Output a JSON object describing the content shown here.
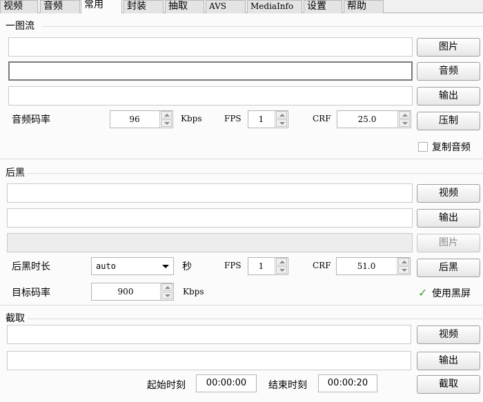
{
  "tabs": [
    {
      "label": "视频"
    },
    {
      "label": "音频"
    },
    {
      "label": "常用"
    },
    {
      "label": "封装"
    },
    {
      "label": "抽取"
    },
    {
      "label": "AVS"
    },
    {
      "label": "MediaInfo"
    },
    {
      "label": "设置"
    },
    {
      "label": "帮助"
    }
  ],
  "active_tab": "常用",
  "section1": {
    "title": "一图流",
    "image_path": "",
    "audio_path": "",
    "output_path": "",
    "btn_image": "图片",
    "btn_audio": "音频",
    "btn_output": "输出",
    "btn_compress": "压制",
    "audio_bitrate_label": "音频码率",
    "audio_bitrate_value": "96",
    "kbps_label": "Kbps",
    "fps_label": "FPS",
    "fps_value": "1",
    "crf_label": "CRF",
    "crf_value": "25.0",
    "copy_audio_label": "复制音频",
    "copy_audio_checked": false
  },
  "section2": {
    "title": "后黑",
    "video_path": "",
    "output_path": "",
    "image_path": "",
    "btn_video": "视频",
    "btn_output": "输出",
    "btn_image": "图片",
    "btn_black": "后黑",
    "duration_label": "后黑时长",
    "duration_value": "auto",
    "seconds_label": "秒",
    "fps_label": "FPS",
    "fps_value": "1",
    "crf_label": "CRF",
    "crf_value": "51.0",
    "target_bitrate_label": "目标码率",
    "target_bitrate_value": "900",
    "kbps_label": "Kbps",
    "use_black_label": "使用黑屏",
    "use_black_checked": true
  },
  "section3": {
    "title": "截取",
    "video_path": "",
    "output_path": "",
    "btn_video": "视频",
    "btn_output": "输出",
    "btn_cut": "截取",
    "start_label": "起始时刻",
    "start_value": "00:00:00",
    "end_label": "结束时刻",
    "end_value": "00:00:20"
  }
}
